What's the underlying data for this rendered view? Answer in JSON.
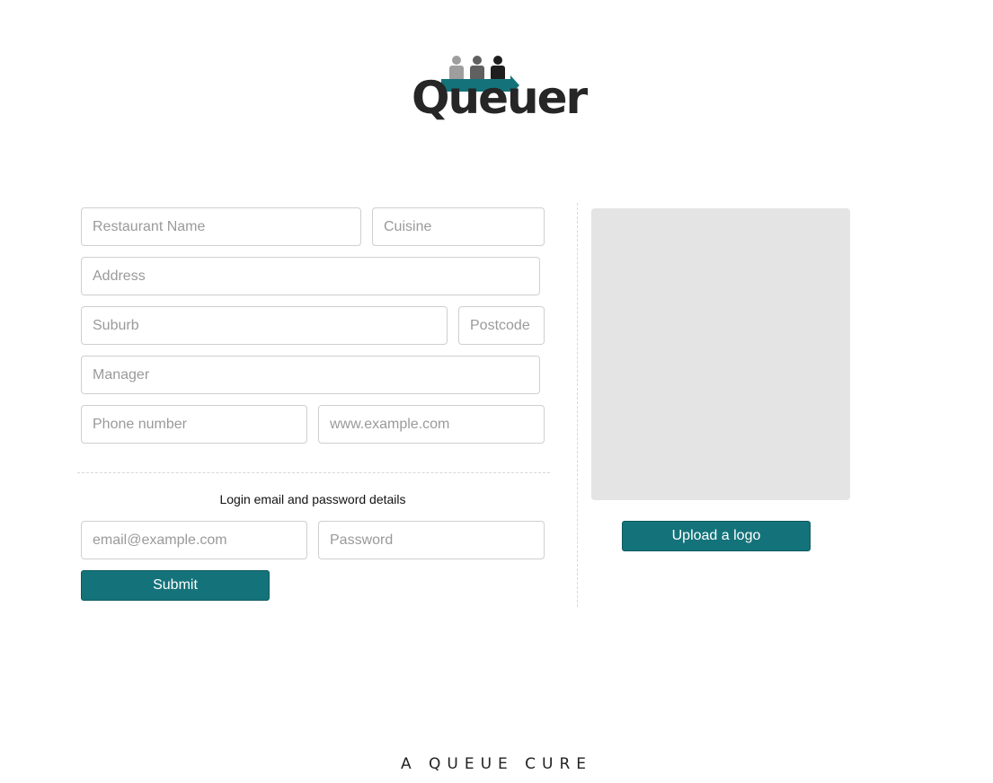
{
  "brand": {
    "name": "Queuer",
    "tagline": "A QUEUE CURE",
    "accent_color": "#14737a"
  },
  "form": {
    "restaurant_name": {
      "placeholder": "Restaurant Name",
      "value": ""
    },
    "cuisine": {
      "placeholder": "Cuisine",
      "value": ""
    },
    "address": {
      "placeholder": "Address",
      "value": ""
    },
    "suburb": {
      "placeholder": "Suburb",
      "value": ""
    },
    "postcode": {
      "placeholder": "Postcode",
      "value": ""
    },
    "manager": {
      "placeholder": "Manager",
      "value": ""
    },
    "phone": {
      "placeholder": "Phone number",
      "value": ""
    },
    "website": {
      "placeholder": "www.example.com",
      "value": ""
    },
    "login_section_label": "Login email and password details",
    "email": {
      "placeholder": "email@example.com",
      "value": ""
    },
    "password": {
      "placeholder": "Password",
      "value": ""
    },
    "submit_label": "Submit"
  },
  "logo_upload": {
    "button_label": "Upload a logo"
  }
}
